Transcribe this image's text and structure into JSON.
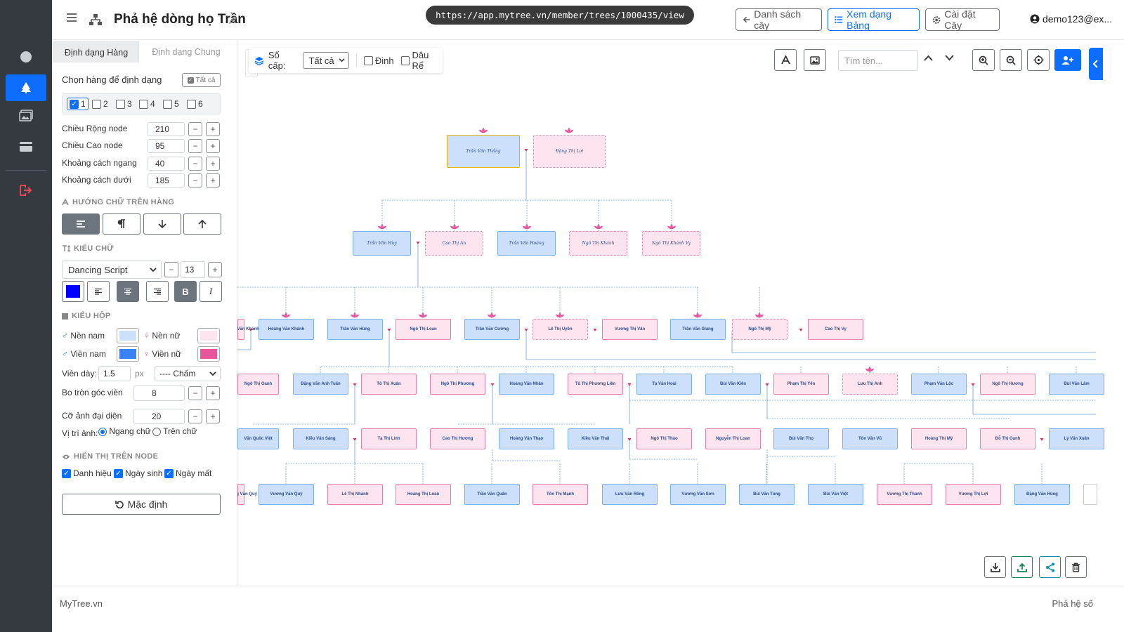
{
  "header": {
    "title": "Phả hệ dòng họ Trần",
    "url": "https://app.mytree.vn/member/trees/1000435/view",
    "btn_list": "Danh sách cây",
    "btn_table": "Xem dạng Bảng",
    "btn_settings": "Cài đặt Cây",
    "user": "demo123@ex..."
  },
  "sidebar": {
    "tab_row": "Định dạng Hàng",
    "tab_general": "Định dạng Chung",
    "choose_rows": "Chọn hàng để định dạng",
    "all_btn": "Tất cả",
    "rows": [
      "1",
      "2",
      "3",
      "4",
      "5",
      "6"
    ],
    "node_width_label": "Chiều Rộng node",
    "node_width": "210",
    "node_height_label": "Chiều Cao node",
    "node_height": "95",
    "hgap_label": "Khoảng cách ngang",
    "hgap": "40",
    "bgap_label": "Khoảng cách dưới",
    "bgap": "185",
    "text_dir_heading": "HƯỚNG CHỮ TRÊN HÀNG",
    "font_heading": "KIỂU CHỮ",
    "font_family": "Dancing Script",
    "font_size": "13",
    "font_color": "#0000ff",
    "bold_glyph": "B",
    "italic_glyph": "I",
    "box_heading": "KIỂU HỘP",
    "male_bg_label": "Nền nam",
    "female_bg_label": "Nền nữ",
    "male_border_label": "Viền nam",
    "female_border_label": "Viền nữ",
    "male_bg": "#cce0fb",
    "female_bg": "#fde4ee",
    "male_border": "#3b82f6",
    "female_border": "#e8559a",
    "border_width_label": "Viền dày:",
    "border_width": "1.5",
    "unit_px": "px",
    "border_style": "---- Chấm",
    "radius_label": "Bo tròn góc viền",
    "radius": "8",
    "avatar_label": "Cỡ ảnh đại diện",
    "avatar": "20",
    "img_pos_label": "Vị trí ảnh:",
    "img_pos_opt1": "Ngang chữ",
    "img_pos_opt2": "Trên chữ",
    "display_heading": "HIỂN THỊ TRÊN NODE",
    "show_title": "Danh hiệu",
    "show_birth": "Ngày sinh",
    "show_death": "Ngày mất",
    "reset_btn": "Mặc định"
  },
  "toolbar": {
    "level_label": "Số cấp:",
    "level_value": "Tất cả",
    "opt_pin": "Đinh",
    "opt_root": "Dâu Rể",
    "search_placeholder": "Tìm tên..."
  },
  "tree": {
    "gen1": [
      "Trần Văn Thắng",
      "Đặng Thị Lợi"
    ],
    "gen2": [
      "Trần Văn Huy",
      "Cao Thị An",
      "Trần Văn Hoàng",
      "Ngô Thị Khánh",
      "Ngô Thị Khánh Vy"
    ],
    "gen3": [
      "Hoàng Văn Khánh",
      "Trần Văn Hùng",
      "Ngô Thị Loan",
      "Trần Văn Cường",
      "Lê Thị Uyên",
      "Vương Thị Vân",
      "Trần Văn Giang",
      "Ngô Thị Mỹ",
      "Cao Thị Vy"
    ],
    "gen4": [
      "Ngô Thị Oanh",
      "Đặng Văn Anh Tuấn",
      "Tô Thị Xuân",
      "Ngô Thị Phương",
      "Hoàng Văn Nhân",
      "Tô Thị Phương Liên",
      "Tạ Văn Hoài",
      "Bùi Văn Kiên",
      "Phạm Thị Yến",
      "Lưu Thị Anh",
      "Phạm Văn Lộc",
      "Ngô Thị Hương",
      "Bùi Văn Lâm"
    ],
    "gen5": [
      "Văn Quốc Việt",
      "Kiều Văn Sáng",
      "Tạ Thị Linh",
      "Cao Thị Hương",
      "Hoàng Văn Thạo",
      "Kiều Văn Thái",
      "Ngô Thị Thảo",
      "Nguyễn Thị Loan",
      "Bùi Văn Thọ",
      "Tôn Văn Vũ",
      "Hoàng Thị Mỹ",
      "Đỗ Thị Oanh",
      "Lý Văn Xuân"
    ],
    "gen6": [
      "Vương Văn Quý",
      "Lê Thị Nhành",
      "Hoàng Thị Loan",
      "Trần Văn Quân",
      "Tôn Thị Mạnh",
      "Lưu Văn Rồng",
      "Vương Văn Sơn",
      "Bùi Văn Tùng",
      "Bùi Văn Việt",
      "Vương Thị Thanh",
      "Vương Thị Lợi",
      "Đặng Văn Hùng"
    ]
  },
  "footer": {
    "left": "MyTree.vn",
    "right": "Phả hệ số"
  },
  "colors": {
    "accent": "#0d6efd",
    "rail": "#343a40",
    "danger": "#dc3545",
    "success": "#198754",
    "lotus": "#e8559a"
  }
}
